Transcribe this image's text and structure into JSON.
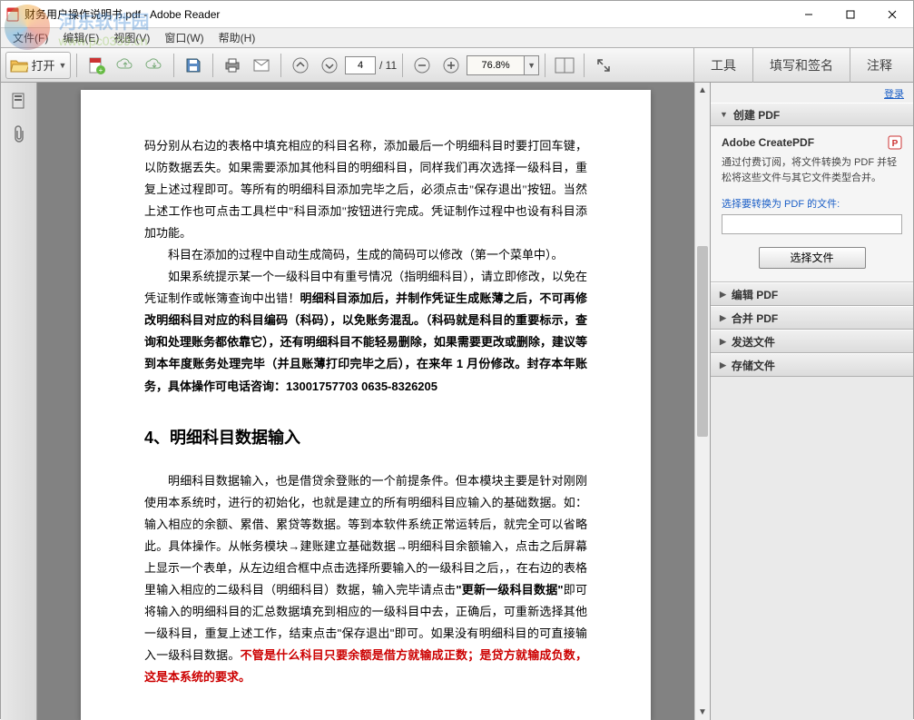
{
  "window": {
    "title": "财务用户操作说明书.pdf - Adobe Reader"
  },
  "watermark": {
    "line1": "河东软件园",
    "line2": "www.pc0359.cn"
  },
  "menu": {
    "file": "文件(F)",
    "edit": "编辑(E)",
    "view": "视图(V)",
    "window": "窗口(W)",
    "help": "帮助(H)"
  },
  "toolbar": {
    "open_label": "打开",
    "current_page": "4",
    "total_pages": "/ 11",
    "zoom": "76.8%",
    "tools": "工具",
    "fill_sign": "填写和签名",
    "comment": "注释"
  },
  "rightpanel": {
    "login": "登录",
    "create_pdf": "创建 PDF",
    "create_pdf_h": "Adobe CreatePDF",
    "create_pdf_desc": "通过付费订阅，将文件转换为 PDF 并轻松将这些文件与其它文件类型合并。",
    "select_label": "选择要转换为 PDF 的文件:",
    "select_btn": "选择文件",
    "edit_pdf": "编辑 PDF",
    "merge_pdf": "合并 PDF",
    "send_file": "发送文件",
    "store_file": "存储文件"
  },
  "doc": {
    "p1": "码分别从右边的表格中填充相应的科目名称，添加最后一个明细科目时要打回车键，以防数据丢失。如果需要添加其他科目的明细科目，同样我们再次选择一级科目，重复上述过程即可。等所有的明细科目添加完毕之后，必须点击\"保存退出\"按钮。当然上述工作也可点击工具栏中\"科目添加\"按钮进行完成。凭证制作过程中也设有科目添加功能。",
    "p2": "科目在添加的过程中自动生成简码，生成的简码可以修改（第一个菜单中）。",
    "p3a": "如果系统提示某一个一级科目中有重号情况（指明细科目），请立即修改，以免在凭证制作或帐簿查询中出错！",
    "p3b": "明细科目添加后，并制作凭证生成账薄之后，不可再修改明细科目对应的科目编码（科码），以免账务混乱。（科码就是科目的重要标示，查询和处理账务都依靠它），还有明细科目不能轻易删除，如果需要更改或删除，建议等到本年度账务处理完毕（并且账薄打印完毕之后），在来年 1 月份修改。封存本年账务，具体操作可电话咨询：13001757703 0635-8326205",
    "h4": "4、明细科目数据输入",
    "p4a": "明细科目数据输入，也是借贷余登账的一个前提条件。但本模块主要是针对刚刚使用本系统时，进行的初始化，也就是建立的所有明细科目应输入的基础数据。如：输入相应的余额、累借、累贷等数据。等到本软件系统正常运转后，就完全可以省略此。具体操作。从帐务模块→建账建立基础数据→明细科目余额输入，点击之后屏幕上显示一个表单，从左边组合框中点击选择所要输入的一级科目之后，，在右边的表格里输入相应的二级科目（明细科目）数据，输入完毕请点击",
    "p4b": "\"更新一级科目数据\"",
    "p4c": "即可将输入的明细科目的汇总数据填充到相应的一级科目中去，正确后，可重新选择其他一级科目，重复上述工作，结束点击\"保存退出\"即可。如果没有明细科目的可直接输入一级科目数据。",
    "p4d": "不管是什么科目只要余额是借方就输成正数；是贷方就输成负数，这是本系统的要求。"
  }
}
